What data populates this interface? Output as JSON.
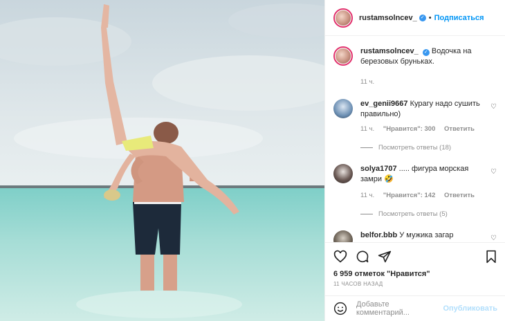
{
  "photo": {
    "description_icon": "beach-photo"
  },
  "header": {
    "username": "rustamsolncev_",
    "verified_mark": "✓",
    "separator": "•",
    "follow_label": "Подписаться"
  },
  "caption": {
    "username": "rustamsolncev_",
    "text": "Водочка на березовых бруньках.",
    "time": "11 ч."
  },
  "comments": [
    {
      "username": "ev_genii9667",
      "text": "Курагу надо сушить правильно)",
      "time": "11 ч.",
      "likes": "\"Нравится\": 300",
      "reply": "Ответить",
      "view_replies": "Посмотреть ответы (18)"
    },
    {
      "username": "solya1707",
      "text": "..... фигура морская замри 🤣",
      "time": "11 ч.",
      "likes": "\"Нравится\": 142",
      "reply": "Ответить",
      "view_replies": "Посмотреть ответы (5)"
    },
    {
      "username": "belfor.bbb",
      "text": "У мужика загар"
    }
  ],
  "likes_count": "6 959 отметок \"Нравится\"",
  "post_time": "11 ЧАСОВ НАЗАД",
  "add_comment": {
    "placeholder": "Добавьте комментарий...",
    "publish": "Опубликовать"
  },
  "colors": {
    "accent": "#0095f6",
    "muted": "#8e8e8e",
    "text": "#262626"
  }
}
